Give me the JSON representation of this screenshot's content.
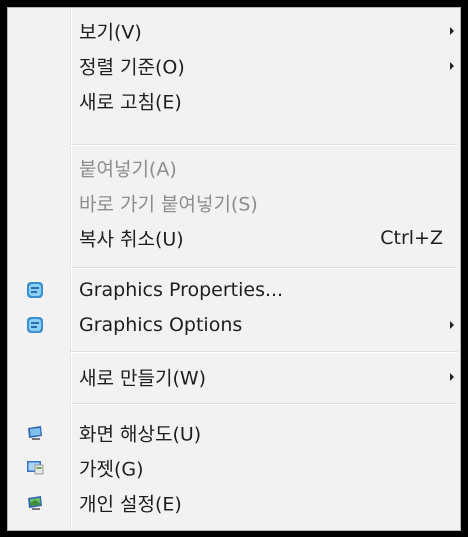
{
  "menu": {
    "items": [
      {
        "label": "보기(V)",
        "submenu": true
      },
      {
        "label": "정렬 기준(O)",
        "submenu": true
      },
      {
        "label": "새로 고침(E)"
      },
      {
        "label": "붙여넣기(A)",
        "disabled": true
      },
      {
        "label": "바로 가기 붙여넣기(S)",
        "disabled": true
      },
      {
        "label": "복사 취소(U)",
        "shortcut": "Ctrl+Z"
      },
      {
        "label": "Graphics Properties...",
        "icon": "intel-graphics-icon"
      },
      {
        "label": "Graphics Options",
        "icon": "intel-graphics-icon",
        "submenu": true
      },
      {
        "label": "새로 만들기(W)",
        "submenu": true
      },
      {
        "label": "화면 해상도(U)",
        "icon": "display-icon"
      },
      {
        "label": "가젯(G)",
        "icon": "gadget-icon"
      },
      {
        "label": "개인 설정(E)",
        "icon": "personalize-icon"
      }
    ]
  },
  "colors": {
    "background": "#f2f2f2",
    "text": "#1e1e1e",
    "disabled_text": "#8d8d8d"
  }
}
